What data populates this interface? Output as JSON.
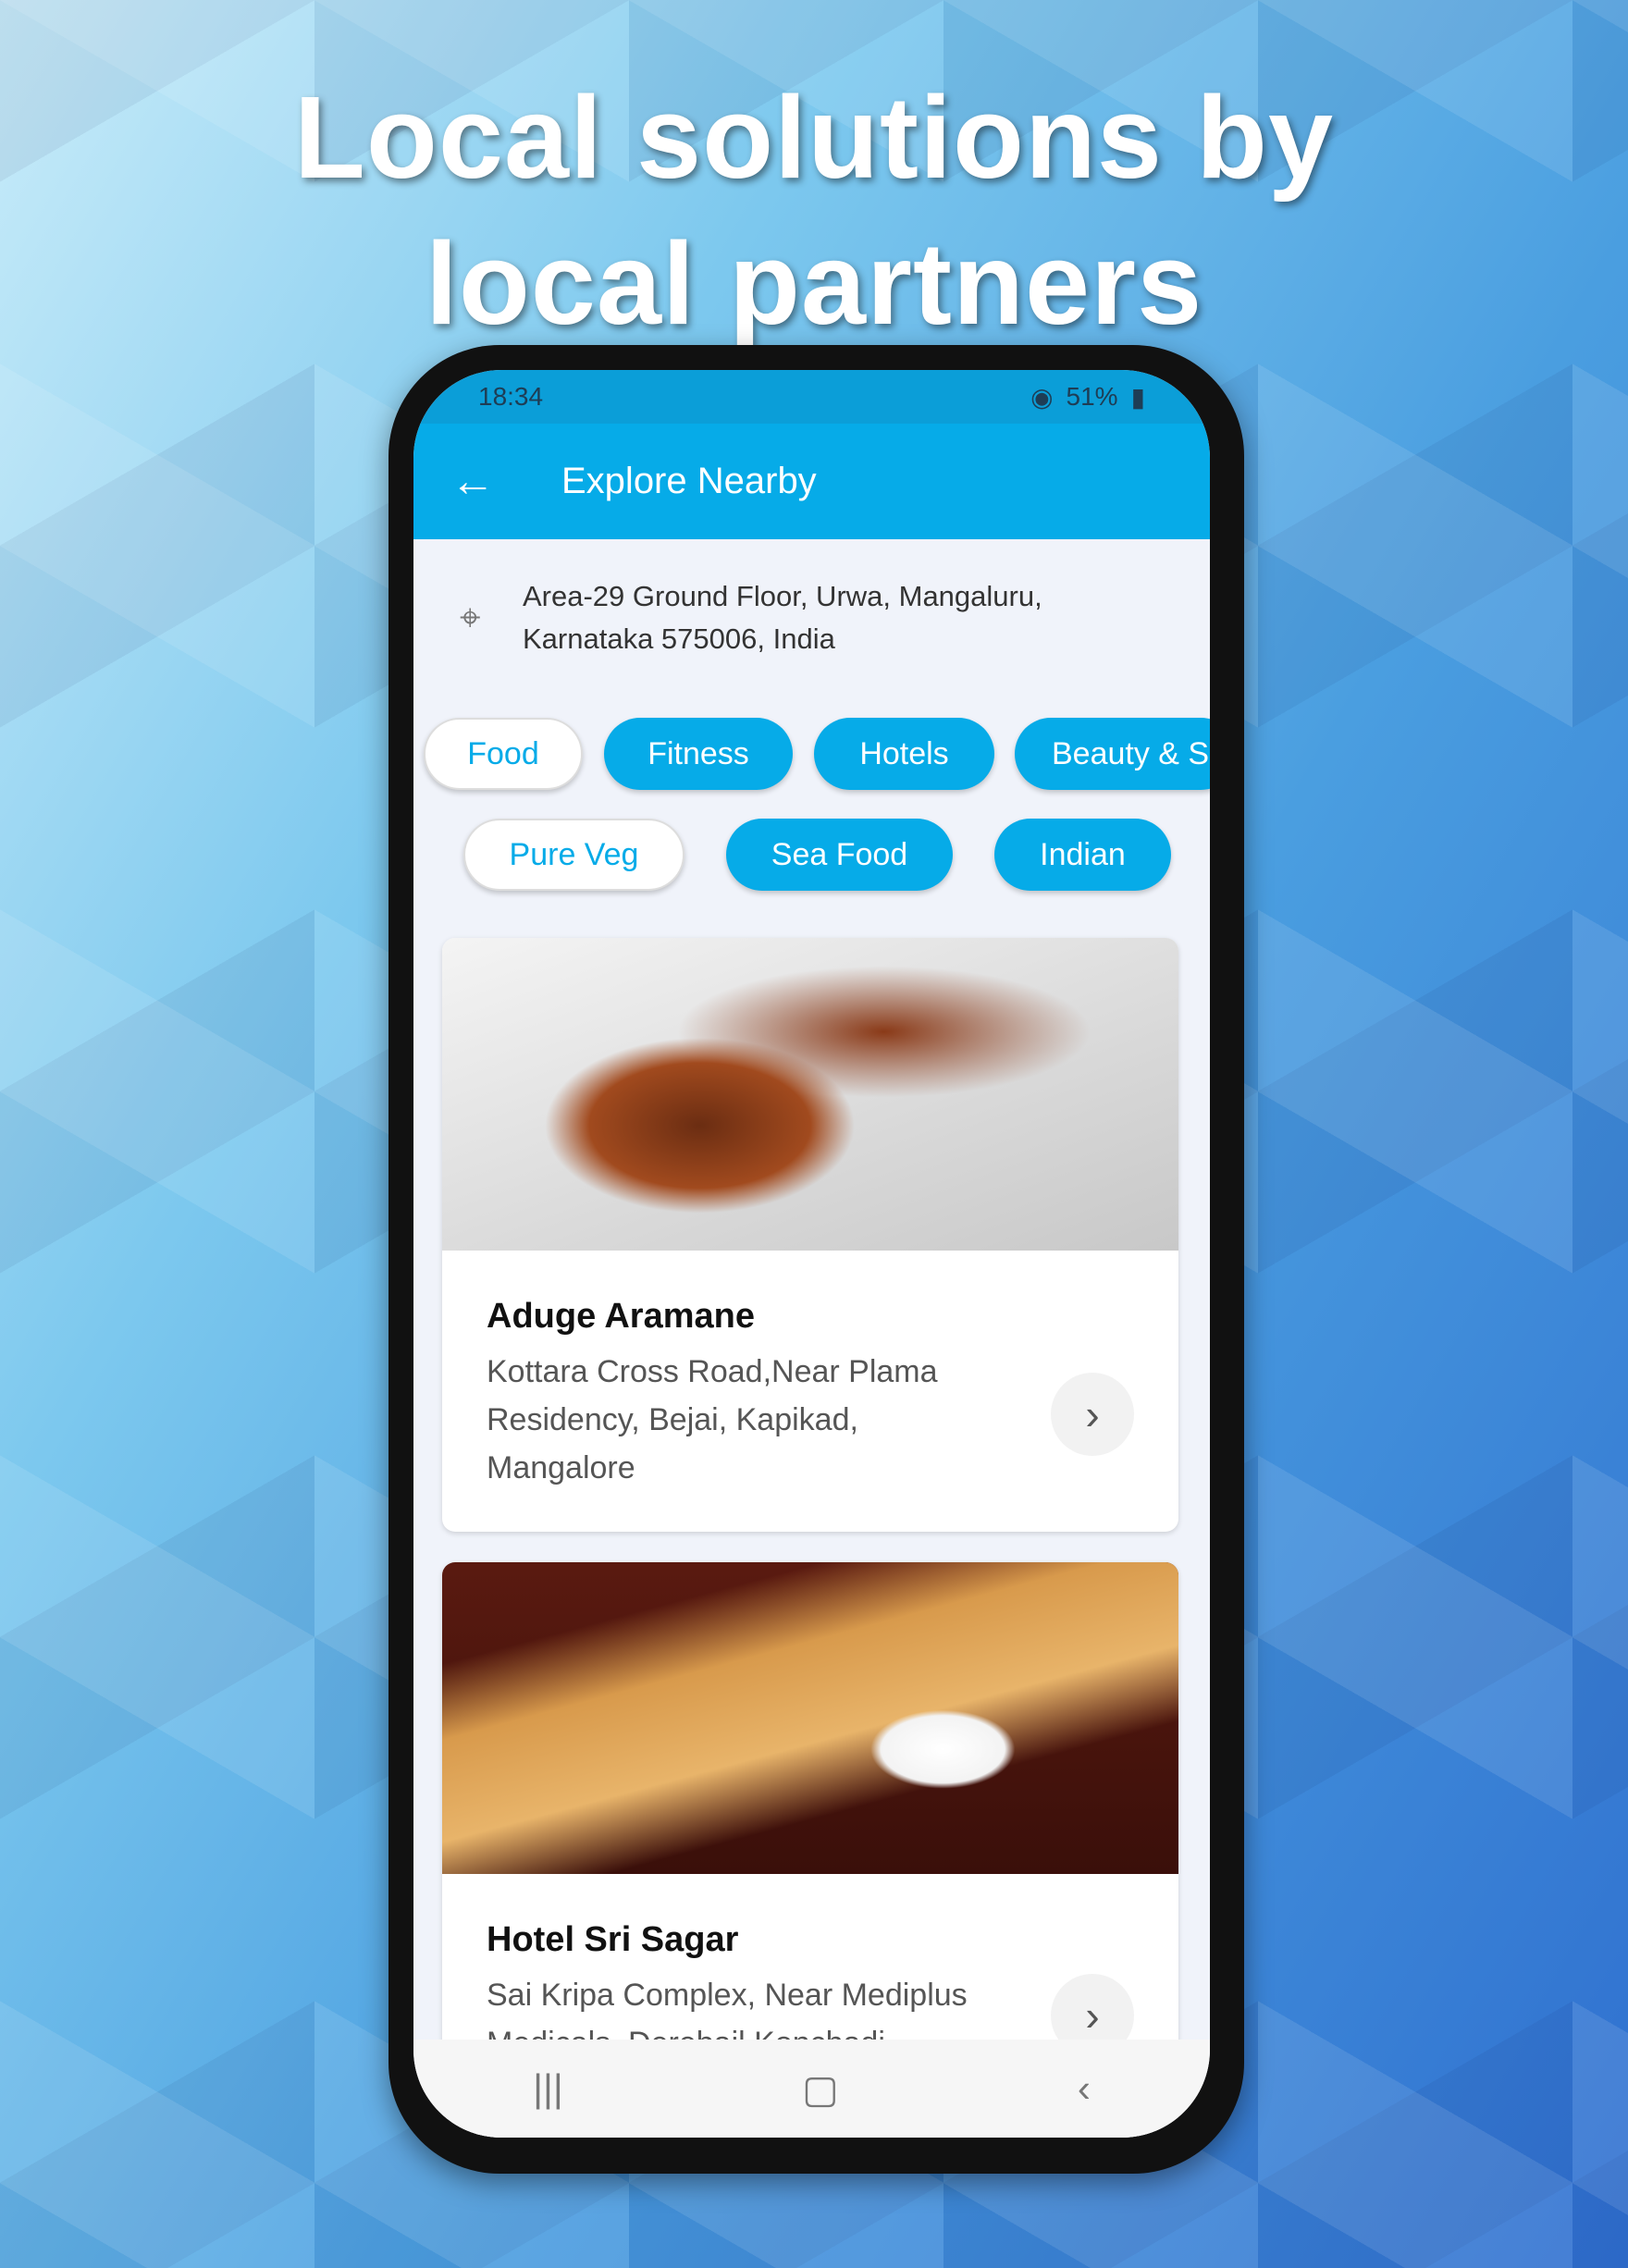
{
  "headline": [
    "Local solutions by",
    "local partners"
  ],
  "status": {
    "time": "18:34",
    "battery": "51%"
  },
  "appbar": {
    "title": "Explore Nearby"
  },
  "location": {
    "line1": "Area-29 Ground Floor, Urwa, Mangaluru,",
    "line2": "Karnataka 575006, India"
  },
  "chips_row1": [
    {
      "label": "Food",
      "selected": false
    },
    {
      "label": "Fitness",
      "selected": true
    },
    {
      "label": "Hotels",
      "selected": true
    },
    {
      "label": "Beauty & S",
      "selected": true
    }
  ],
  "chips_row2": [
    {
      "label": "Pure Veg",
      "selected": false
    },
    {
      "label": "Sea Food",
      "selected": true
    },
    {
      "label": "Indian",
      "selected": true
    }
  ],
  "listings": [
    {
      "name": "Aduge Aramane",
      "address": "Kottara Cross Road,Near Plama Residency, Bejai, Kapikad, Mangalore"
    },
    {
      "name": "Hotel Sri Sagar",
      "address": "Sai Kripa Complex, Near Mediplus Medicals, Derebail Konchadi"
    }
  ],
  "colors": {
    "primary": "#06abe8"
  }
}
